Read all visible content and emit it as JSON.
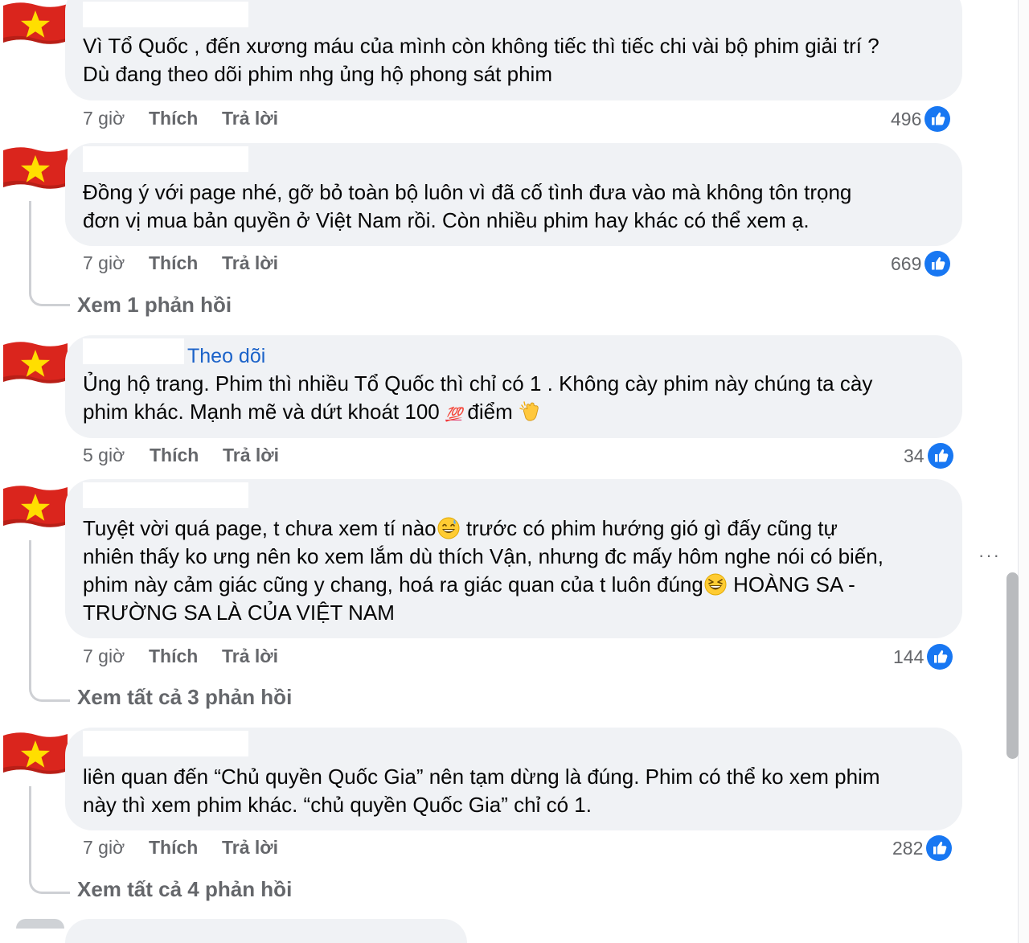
{
  "colors": {
    "bubble": "#f0f2f5",
    "flag_red": "#da251d",
    "flag_star": "#ffde00",
    "like_blue": "#1877f2",
    "link": "#1c63c9",
    "meta": "#65676b"
  },
  "icons": {
    "avatar": "vietnam-flag-icon",
    "like": "thumbs-up-icon",
    "more": "more-options-icon"
  },
  "comments": [
    {
      "lines": [
        "Vì Tổ Quốc , đến xương máu của mình còn không tiếc thì tiếc chi vài bộ phim giải trí ?",
        "Dù đang theo dõi phim nhg ủng hộ phong sát phim"
      ],
      "time": "7 giờ",
      "like": "Thích",
      "reply": "Trả lời",
      "reactions": "496"
    },
    {
      "lines": [
        "Đồng ý với page nhé, gỡ bỏ toàn bộ luôn vì đã cố tình đưa vào mà không tôn trọng",
        "đơn vị mua bản quyền ở Việt Nam rồi. Còn nhiều phim hay khác có thể xem ạ."
      ],
      "time": "7 giờ",
      "like": "Thích",
      "reply": "Trả lời",
      "reactions": "669",
      "view_replies": "Xem 1 phản hồi"
    },
    {
      "follow": "Theo dõi",
      "line1": "Ủng hộ trang. Phim thì nhiều Tổ Quốc thì chỉ có 1 . Không cày phim này chúng ta cày",
      "line2_a": "phim khác. Mạnh mẽ và dứt khoát 100 ",
      "line2_emoji_100": "💯",
      "line2_b": " điểm ",
      "emoji_clap": "clapping-hands-emoji",
      "time": "5 giờ",
      "like": "Thích",
      "reply": "Trả lời",
      "reactions": "34"
    },
    {
      "line1_a": "Tuyệt vời quá page, t chưa xem tí nào",
      "emoji_sweat": "grinning-sweat-emoji",
      "line1_b": " trước có phim hướng gió gì đấy cũng tự",
      "line2": "nhiên thấy ko ưng nên ko xem lắm dù thích Vận, nhưng đc mấy hôm nghe nói có biến,",
      "line3_a": "phim này cảm giác cũng y chang, hoá ra giác quan của t luôn đúng",
      "emoji_laugh": "laughing-emoji",
      "line3_b": " HOÀNG SA -",
      "line4": "TRƯỜNG SA LÀ CỦA VIỆT NAM",
      "time": "7 giờ",
      "like": "Thích",
      "reply": "Trả lời",
      "reactions": "144",
      "view_replies": "Xem tất cả 3 phản hồi"
    },
    {
      "lines": [
        "liên quan đến “Chủ quyền Quốc Gia” nên tạm dừng là đúng. Phim có thể ko xem phim",
        "này thì xem phim khác. “chủ quyền Quốc Gia” chỉ có 1."
      ],
      "time": "7 giờ",
      "like": "Thích",
      "reply": "Trả lời",
      "reactions": "282",
      "view_replies": "Xem tất cả 4 phản hồi"
    }
  ],
  "more_button": "···"
}
